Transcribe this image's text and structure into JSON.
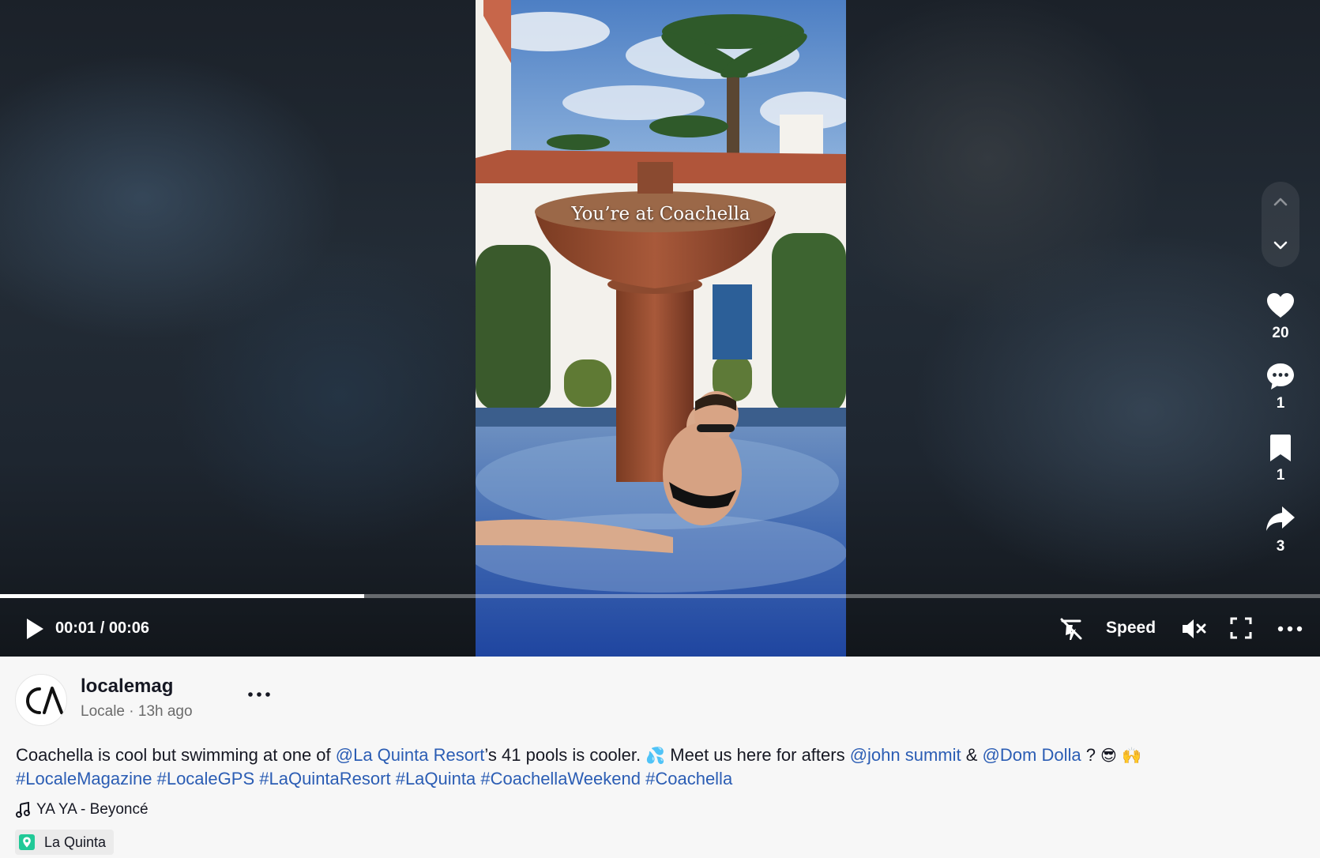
{
  "video": {
    "overlay_text": "You’re at Coachella",
    "progress_fraction": 0.276,
    "time_current": "00:01",
    "time_separator": " / ",
    "time_total": "00:06",
    "speed_label": "Speed"
  },
  "actions": {
    "likes": "20",
    "comments": "1",
    "saves": "1",
    "shares": "3"
  },
  "post": {
    "username": "localemag",
    "display_name": "Locale",
    "dot": " · ",
    "time_ago": "13h ago",
    "caption": {
      "part1": "Coachella is cool but swimming at one of ",
      "mention1": "@La Quinta Resort",
      "part2": "’s 41 pools is cooler. ",
      "emoji1": "💦",
      "part3": " Meet us here for afters ",
      "mention2": "@john summit",
      "part4": " & ",
      "mention3": "@Dom Dolla",
      "part5": " ? ",
      "emoji2": "😎",
      "emoji3": "🙌",
      "hashtags": [
        "#LocaleMagazine",
        "#LocaleGPS",
        "#LaQuintaResort",
        "#LaQuinta",
        "#CoachellaWeekend",
        "#Coachella"
      ]
    },
    "music": "YA YA - Beyoncé",
    "location": "La Quinta"
  },
  "icons": {
    "play": "play-icon",
    "autoscroll": "autoscroll-icon",
    "mute": "muted-speaker-icon",
    "fullscreen": "fullscreen-icon",
    "more": "ellipsis-icon",
    "like": "heart-icon",
    "comment": "speech-bubble-icon",
    "save": "bookmark-icon",
    "share": "share-arrow-icon",
    "music": "music-note-icon",
    "location": "location-pin-icon"
  },
  "colors": {
    "link": "#2b5db4",
    "location_pin": "#20c997"
  }
}
